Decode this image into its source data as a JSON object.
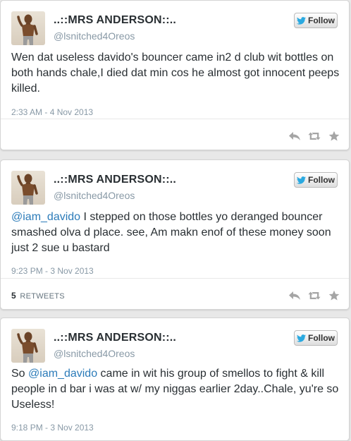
{
  "tweets": [
    {
      "display_name": "..::MRS ANDERSON::..",
      "handle": "@lsnitched4Oreos",
      "follow_label": "Follow",
      "parts": {
        "text": "Wen dat useless davido's bouncer came in2 d club wit bottles on both hands chale,I died dat min cos he almost got innocent peeps killed."
      },
      "timestamp": "2:33 AM - 4 Nov 2013"
    },
    {
      "display_name": "..::MRS ANDERSON::..",
      "handle": "@lsnitched4Oreos",
      "follow_label": "Follow",
      "parts": {
        "mention": "@iam_davido",
        "text": " I stepped on those bottles yo deranged bouncer smashed olva d place. see, Am makn enof of these money soon just 2 sue u bastard"
      },
      "timestamp": "9:23 PM - 3 Nov 2013",
      "retweet_count": "5",
      "retweet_label": "RETWEETS"
    },
    {
      "display_name": "..::MRS ANDERSON::..",
      "handle": "@lsnitched4Oreos",
      "follow_label": "Follow",
      "parts": {
        "pre": "So ",
        "mention": "@iam_davido",
        "text": " came in wit his group of smellos to fight & kill people in d bar i was at w/ my niggas earlier 2day..Chale, yu're so Useless!"
      },
      "timestamp": "9:18 PM - 3 Nov 2013"
    }
  ],
  "icons": {
    "bird": "twitter-bird-icon",
    "reply": "reply-icon",
    "retweet": "retweet-icon",
    "favorite": "favorite-star-icon"
  },
  "colors": {
    "link": "#2b7bb9",
    "bird": "#2aa9e0",
    "muted": "#8899a6",
    "action": "#a5a5a5"
  }
}
